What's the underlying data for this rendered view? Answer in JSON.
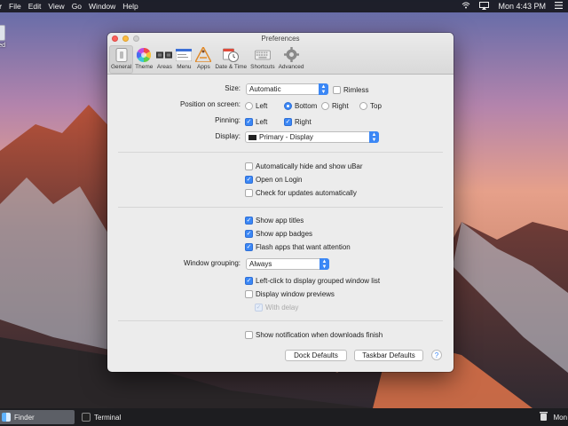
{
  "menubar": {
    "app_name": "er",
    "items": [
      "File",
      "Edit",
      "View",
      "Go",
      "Window",
      "Help"
    ],
    "clock": "Mon 4:43 PM"
  },
  "desktop": {
    "drive_label": "ared"
  },
  "window": {
    "title": "Preferences",
    "toolbar": [
      {
        "label": "General",
        "icon": "switch-icon"
      },
      {
        "label": "Theme",
        "icon": "color-wheel-icon"
      },
      {
        "label": "Areas",
        "icon": "areas-icon"
      },
      {
        "label": "Menu",
        "icon": "menu-icon"
      },
      {
        "label": "Apps",
        "icon": "apps-icon"
      },
      {
        "label": "Date & Time",
        "icon": "clock-icon"
      },
      {
        "label": "Shortcuts",
        "icon": "keyboard-icon"
      },
      {
        "label": "Advanced",
        "icon": "gear-icon"
      }
    ],
    "size": {
      "label": "Size:",
      "value": "Automatic",
      "rimless": "Rimless",
      "rimless_checked": false
    },
    "position": {
      "label": "Position on screen:",
      "options": [
        "Left",
        "Bottom",
        "Right",
        "Top"
      ],
      "selected": "Bottom"
    },
    "pinning": {
      "label": "Pinning:",
      "left": "Left",
      "right": "Right",
      "left_checked": true,
      "right_checked": true
    },
    "display": {
      "label": "Display:",
      "value": "Primary - Display"
    },
    "group2": [
      {
        "label": "Automatically hide and show uBar",
        "checked": false
      },
      {
        "label": "Open on Login",
        "checked": true
      },
      {
        "label": "Check for updates automatically",
        "checked": false
      }
    ],
    "group3": [
      {
        "label": "Show app titles",
        "checked": true
      },
      {
        "label": "Show app badges",
        "checked": true
      },
      {
        "label": "Flash apps that want attention",
        "checked": true
      }
    ],
    "window_grouping": {
      "label": "Window grouping:",
      "value": "Always"
    },
    "group4": [
      {
        "label": "Left-click to display grouped window list",
        "checked": true
      },
      {
        "label": "Display window previews",
        "checked": false
      }
    ],
    "with_delay": {
      "label": "With delay",
      "checked": true,
      "disabled": true
    },
    "notify": {
      "label": "Show notification when downloads finish",
      "checked": false
    },
    "dock_defaults": "Dock Defaults",
    "taskbar_defaults": "Taskbar Defaults",
    "help": "?"
  },
  "taskbar": {
    "tasks": [
      {
        "label": "Finder",
        "active": true
      },
      {
        "label": "Terminal",
        "active": false
      }
    ],
    "clock": "Mon T"
  }
}
